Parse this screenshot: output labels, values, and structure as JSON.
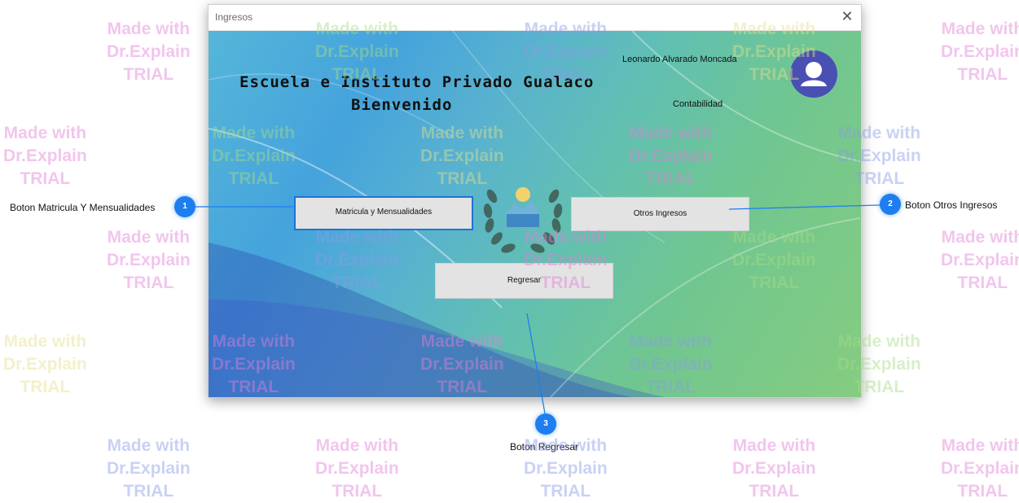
{
  "window": {
    "title": "Ingresos",
    "close_glyph": "✕"
  },
  "header": {
    "school_name": "Escuela e Instituto Privado Gualaco",
    "welcome": "Bienvenido",
    "user_name": "Leonardo  Alvarado Moncada",
    "user_role": "Contabilidad",
    "avatar_icon": "user-icon"
  },
  "buttons": {
    "matricula": "Matricula y Mensualidades",
    "otros": "Otros Ingresos",
    "regresar": "Regresar"
  },
  "callouts": [
    {
      "number": "1",
      "label": "Boton Matricula Y Mensualidades"
    },
    {
      "number": "2",
      "label": "Boton Otros Ingresos"
    },
    {
      "number": "3",
      "label": "Boton Regresar"
    }
  ],
  "watermark": {
    "line1": "Made with",
    "line2": "Dr.Explain",
    "line3": "TRIAL"
  },
  "colors": {
    "marker": "#1e7ef0",
    "focus_border": "#1e73d8",
    "avatar": "#4a4fb3"
  }
}
